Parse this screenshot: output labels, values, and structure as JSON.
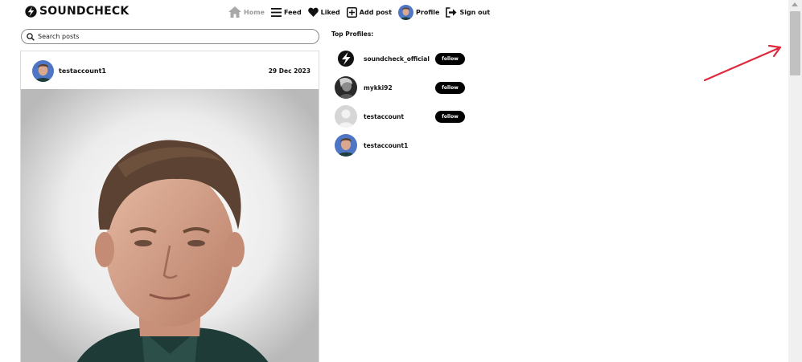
{
  "brand": {
    "name": "SOUNDCHECK"
  },
  "nav": {
    "items": [
      {
        "label": "Home",
        "icon": "home-icon",
        "active": true
      },
      {
        "label": "Feed",
        "icon": "feed-icon",
        "active": false
      },
      {
        "label": "Liked",
        "icon": "heart-icon",
        "active": false
      },
      {
        "label": "Add post",
        "icon": "add-post-icon",
        "active": false
      },
      {
        "label": "Profile",
        "icon": "avatar",
        "active": false
      },
      {
        "label": "Sign out",
        "icon": "sign-out-icon",
        "active": false
      }
    ]
  },
  "search": {
    "placeholder": "Search posts",
    "value": ""
  },
  "post": {
    "username": "testaccount1",
    "date": "29 Dec 2023"
  },
  "top_profiles": {
    "title": "Top Profiles:",
    "profiles": [
      {
        "name": "soundcheck_official",
        "follow_label": "follow"
      },
      {
        "name": "mykki92",
        "follow_label": "follow"
      },
      {
        "name": "testaccount",
        "follow_label": "follow"
      },
      {
        "name": "testaccount1"
      }
    ]
  },
  "colors": {
    "accent": "#000000",
    "active_nav": "#9a9a9a",
    "arrow": "#e0283c"
  }
}
